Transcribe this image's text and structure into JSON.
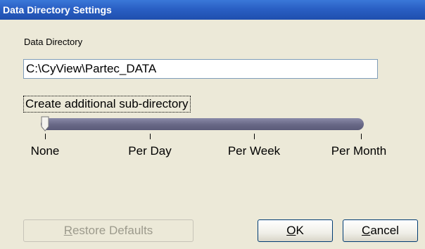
{
  "window": {
    "title": "Data Directory Settings"
  },
  "data_directory": {
    "label": "Data Directory",
    "value": "C:\\CyView\\Partec_DATA"
  },
  "subdirectory": {
    "label": "Create additional sub-directory",
    "options": [
      "None",
      "Per Day",
      "Per Week",
      "Per Month"
    ],
    "selected": "None"
  },
  "buttons": {
    "restore": {
      "access": "R",
      "rest": "estore Defaults"
    },
    "ok": {
      "access": "O",
      "rest": "K"
    },
    "cancel": {
      "access": "C",
      "rest": "ancel"
    }
  }
}
